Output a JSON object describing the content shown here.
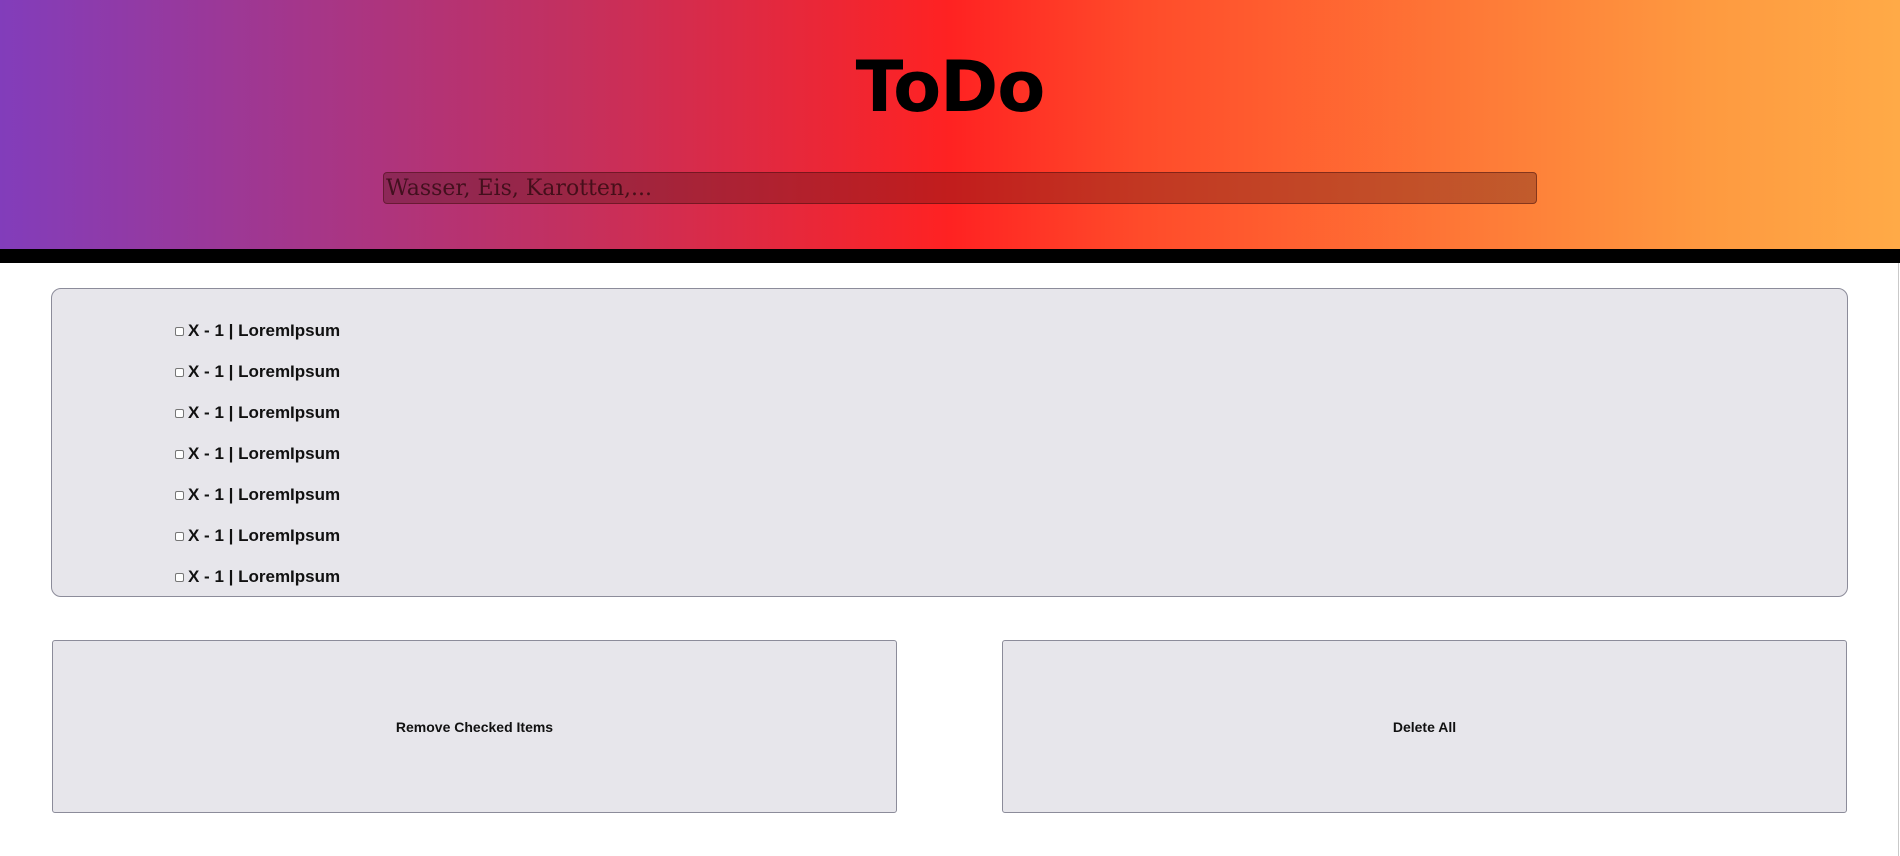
{
  "header": {
    "title": "ToDo",
    "input_placeholder": "Wasser, Eis, Karotten,..."
  },
  "todo_list": {
    "items": [
      {
        "label": "X - 1 | LoremIpsum",
        "checked": false
      },
      {
        "label": "X - 1 | LoremIpsum",
        "checked": false
      },
      {
        "label": "X - 1 | LoremIpsum",
        "checked": false
      },
      {
        "label": "X - 1 | LoremIpsum",
        "checked": false
      },
      {
        "label": "X - 1 | LoremIpsum",
        "checked": false
      },
      {
        "label": "X - 1 | LoremIpsum",
        "checked": false
      },
      {
        "label": "X - 1 | LoremIpsum",
        "checked": false
      }
    ]
  },
  "actions": {
    "remove_checked_label": "Remove Checked Items",
    "delete_all_label": "Delete All"
  },
  "colors": {
    "gradient_start": "#823dbb",
    "gradient_mid": "#ff2222",
    "gradient_end": "#ffaa47",
    "panel_bg": "#e7e6eb",
    "header_bar": "#000000"
  }
}
